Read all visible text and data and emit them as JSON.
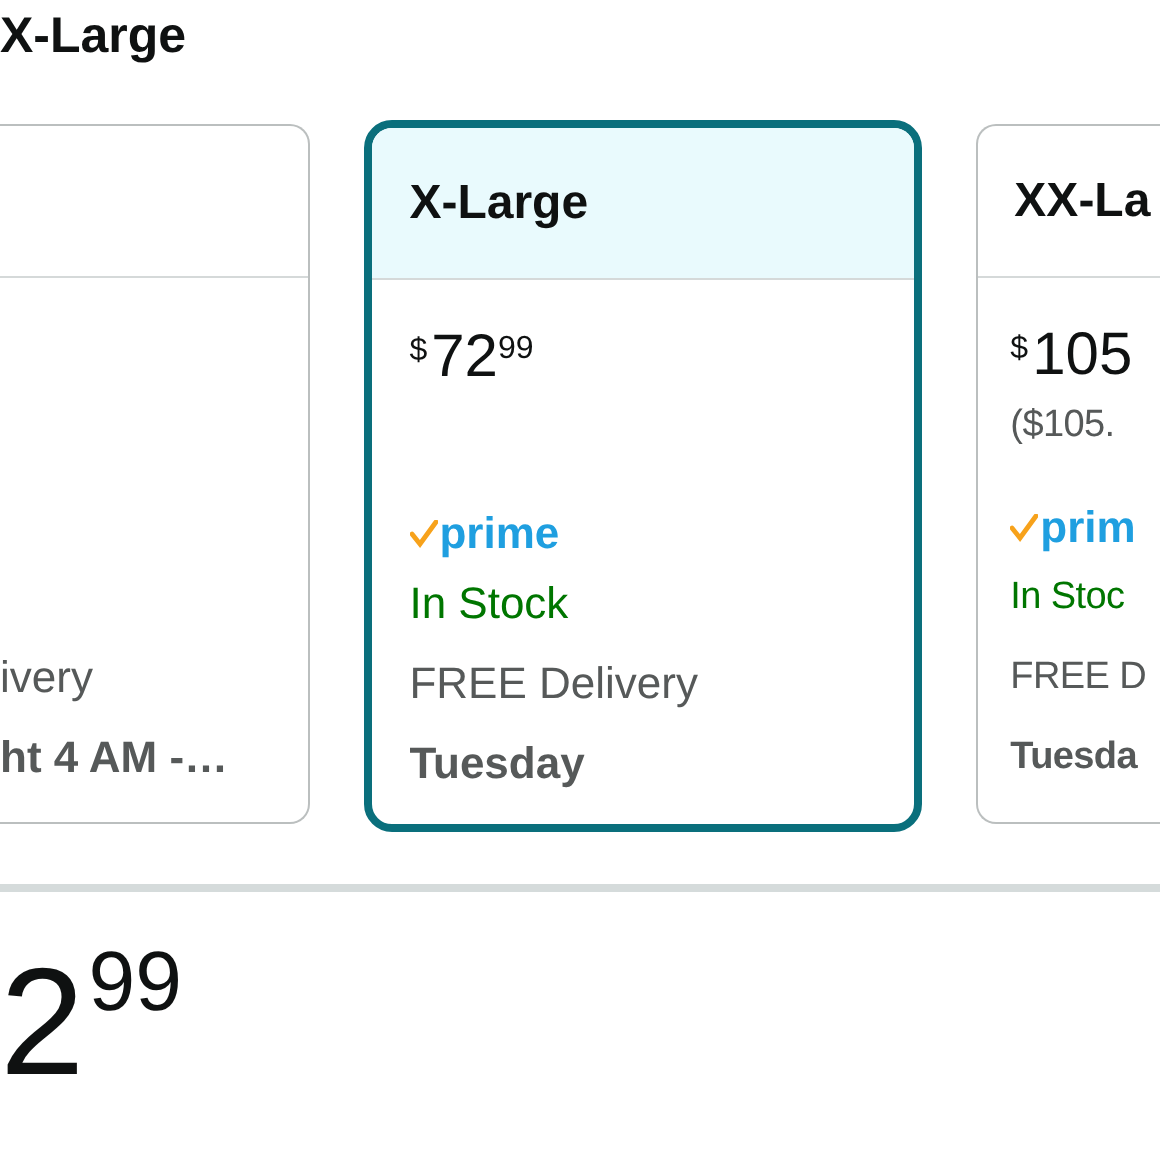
{
  "heading": "X-Large",
  "cards": [
    {
      "selected": false,
      "delivery": "ivery",
      "date": "ht 4 AM -…"
    },
    {
      "selected": true,
      "size": "X-Large",
      "price": {
        "symbol": "$",
        "whole": "72",
        "fraction": "99"
      },
      "prime": "prime",
      "stock": "In Stock",
      "delivery": "FREE Delivery",
      "date": "Tuesday"
    },
    {
      "selected": false,
      "size": "XX-La",
      "price": {
        "symbol": "$",
        "whole": "105"
      },
      "unit_price": "($105.",
      "prime": "prim",
      "stock": "In Stoc",
      "delivery": "FREE D",
      "date": "Tuesda"
    }
  ],
  "price": {
    "whole": "2",
    "fraction": "99"
  }
}
